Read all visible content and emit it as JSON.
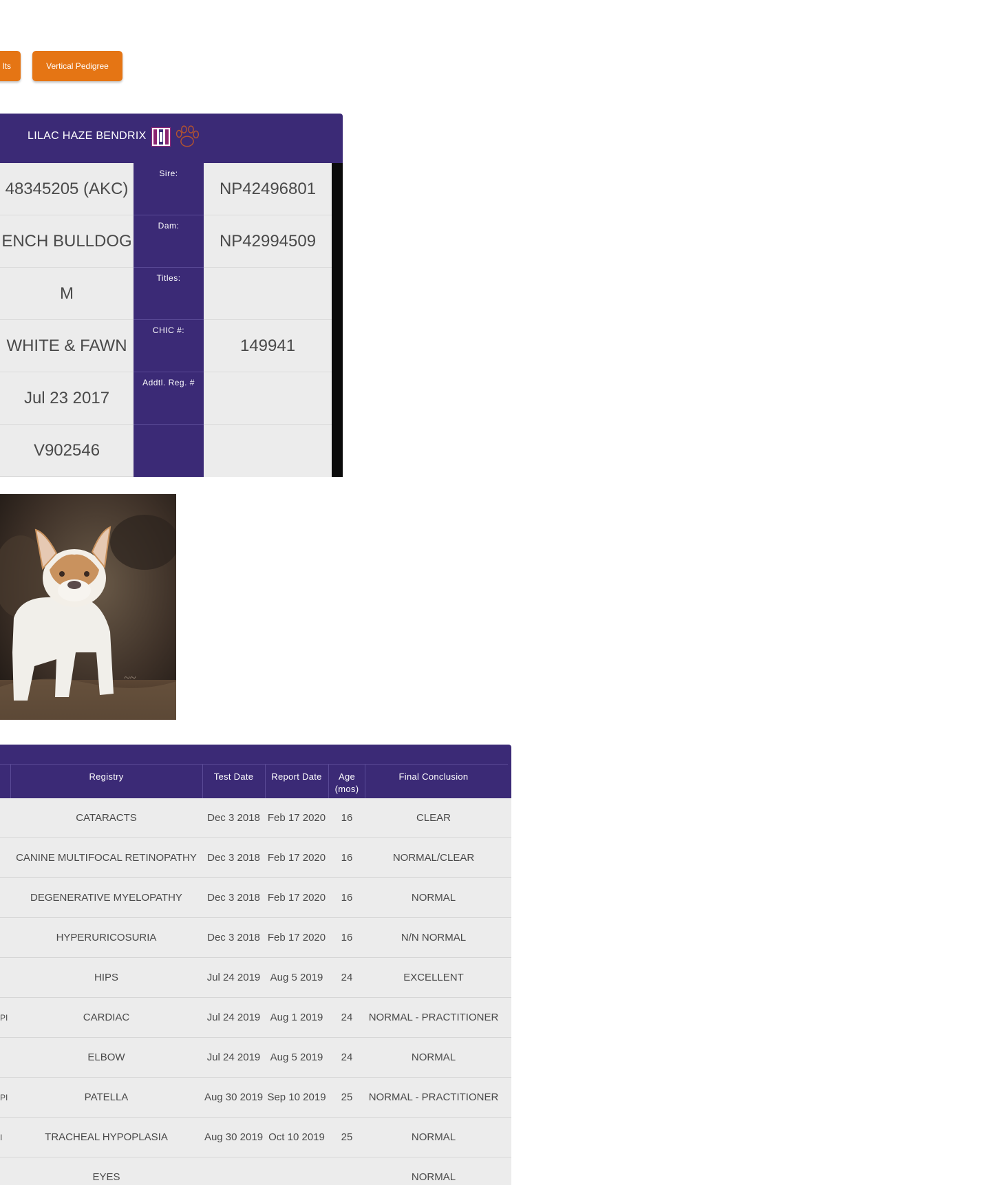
{
  "buttons": {
    "results_label": "lts",
    "vertical_pedigree_label": "Vertical Pedigree"
  },
  "dog": {
    "name": "LILAC HAZE BENDRIX",
    "left_values": [
      "48345205 (AKC)",
      "ENCH BULLDOG",
      "M",
      "WHITE & FAWN",
      "Jul 23 2017",
      "V902546"
    ],
    "labels": [
      "Sire:",
      "Dam:",
      "Titles:",
      "CHIC #:",
      "Addtl. Reg. #",
      ""
    ],
    "right_values": [
      "NP42496801",
      "NP42994509",
      "",
      "149941",
      "",
      ""
    ]
  },
  "health_table": {
    "headers": {
      "registry": "Registry",
      "test_date": "Test Date",
      "report_date": "Report Date",
      "age": "Age (mos)",
      "final_conclusion": "Final Conclusion"
    },
    "rows": [
      {
        "prefix": "",
        "registry": "CATARACTS",
        "test_date": "Dec 3 2018",
        "report_date": "Feb 17 2020",
        "age": "16",
        "conclusion": "CLEAR"
      },
      {
        "prefix": "",
        "registry": "CANINE MULTIFOCAL RETINOPATHY",
        "test_date": "Dec 3 2018",
        "report_date": "Feb 17 2020",
        "age": "16",
        "conclusion": "NORMAL/CLEAR"
      },
      {
        "prefix": "",
        "registry": "DEGENERATIVE MYELOPATHY",
        "test_date": "Dec 3 2018",
        "report_date": "Feb 17 2020",
        "age": "16",
        "conclusion": "NORMAL"
      },
      {
        "prefix": "",
        "registry": "HYPERURICOSURIA",
        "test_date": "Dec 3 2018",
        "report_date": "Feb 17 2020",
        "age": "16",
        "conclusion": "N/N NORMAL"
      },
      {
        "prefix": "",
        "registry": "HIPS",
        "test_date": "Jul 24 2019",
        "report_date": "Aug 5 2019",
        "age": "24",
        "conclusion": "EXCELLENT"
      },
      {
        "prefix": "PI",
        "registry": "CARDIAC",
        "test_date": "Jul 24 2019",
        "report_date": "Aug 1 2019",
        "age": "24",
        "conclusion": "NORMAL - PRACTITIONER"
      },
      {
        "prefix": "",
        "registry": "ELBOW",
        "test_date": "Jul 24 2019",
        "report_date": "Aug 5 2019",
        "age": "24",
        "conclusion": "NORMAL"
      },
      {
        "prefix": "PI",
        "registry": "PATELLA",
        "test_date": "Aug 30 2019",
        "report_date": "Sep 10 2019",
        "age": "25",
        "conclusion": "NORMAL - PRACTITIONER"
      },
      {
        "prefix": "I",
        "registry": "TRACHEAL HYPOPLASIA",
        "test_date": "Aug 30 2019",
        "report_date": "Oct 10 2019",
        "age": "25",
        "conclusion": "NORMAL"
      },
      {
        "prefix": "",
        "registry": "EYES",
        "test_date": "",
        "report_date": "",
        "age": "",
        "conclusion": "NORMAL"
      }
    ]
  },
  "colors": {
    "header_purple": "#3b2a76",
    "button_orange": "#e57514",
    "cell_gray": "#ececec"
  }
}
